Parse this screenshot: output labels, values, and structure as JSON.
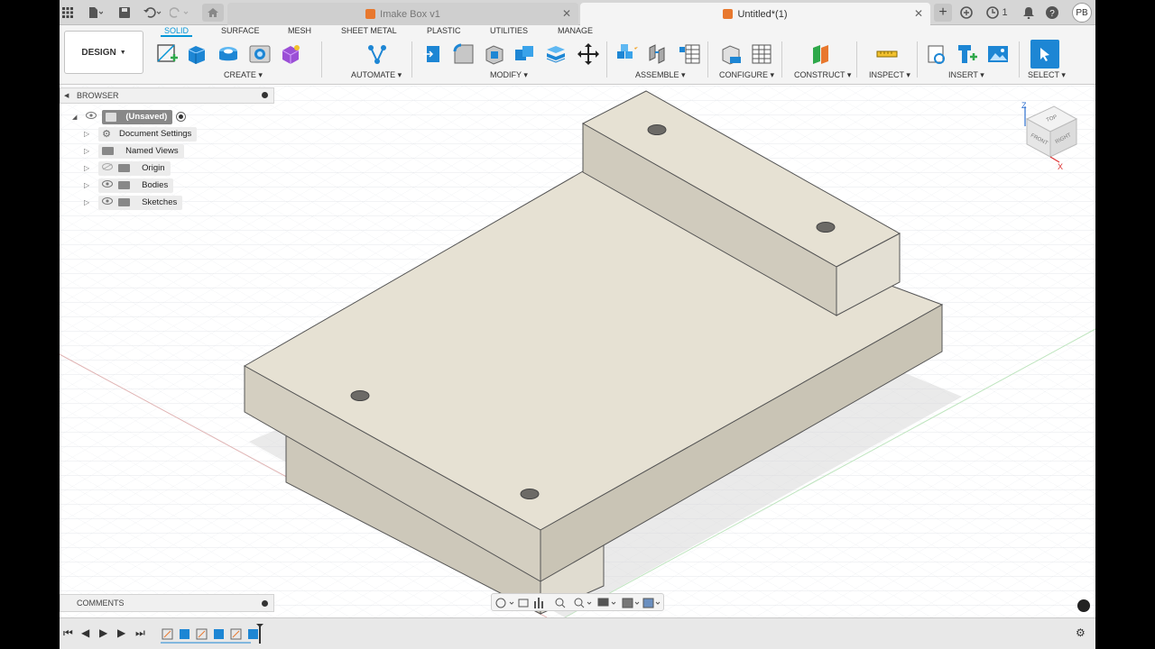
{
  "top_bar": {
    "inactive_tab_label": "Imake Box v1",
    "active_tab_label": "Untitled*(1)",
    "notification_count": "1",
    "user_initials": "PB",
    "icons": [
      "grid-icon",
      "file-icon",
      "save-icon",
      "undo-icon",
      "redo-icon",
      "home-icon",
      "add-tab-icon",
      "job-status-icon",
      "notifications-icon",
      "help-icon"
    ]
  },
  "toolbar": {
    "workspace_label": "DESIGN",
    "tabs": [
      "SOLID",
      "SURFACE",
      "MESH",
      "SHEET METAL",
      "PLASTIC",
      "UTILITIES",
      "MANAGE"
    ],
    "active_tab": "SOLID",
    "groups": [
      "CREATE",
      "AUTOMATE",
      "MODIFY",
      "ASSEMBLE",
      "CONFIGURE",
      "CONSTRUCT",
      "INSPECT",
      "INSERT",
      "SELECT"
    ],
    "accent_color": "#0696d7"
  },
  "browser": {
    "title": "BROWSER",
    "root": "(Unsaved)",
    "items": [
      "Document Settings",
      "Named Views",
      "Origin",
      "Bodies",
      "Sketches"
    ]
  },
  "view_cube": {
    "top": "TOP",
    "front": "FRONT",
    "right": "RIGHT",
    "axis_z": "Z",
    "axis_x": "X"
  },
  "comments": {
    "title": "COMMENTS"
  },
  "timeline": {
    "icons": [
      "skip-start-icon",
      "step-back-icon",
      "play-icon",
      "step-forward-icon",
      "skip-end-icon",
      "settings-icon"
    ]
  },
  "colors": {
    "model_face_top": "#e4e0d4",
    "model_face_side": "#cfcabc",
    "model_face_dark": "#bdb8aa"
  }
}
